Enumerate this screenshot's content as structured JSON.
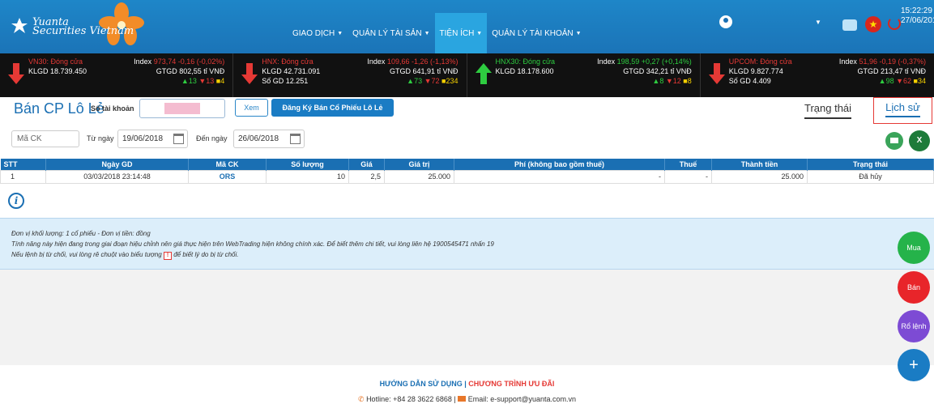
{
  "brand": {
    "logo_text_1": "Yuanta",
    "logo_text_2": "Securities Vietnam"
  },
  "nav": [
    {
      "label": "GIAO DỊCH",
      "has_caret": true
    },
    {
      "label": "QUẢN LÝ TÀI SẢN",
      "has_caret": true
    },
    {
      "label": "TIỆN ÍCH",
      "has_caret": true,
      "active": true
    },
    {
      "label": "QUẢN LÝ TÀI KHOẢN",
      "has_caret": true
    }
  ],
  "clock": {
    "time": "15:22:29",
    "date": "27/06/2018"
  },
  "indices": [
    {
      "name": "VN30: Đóng cửa",
      "klgd": "KLGD 18.739.450",
      "sogd": "",
      "index_label": "Index",
      "index_value": "973,74 -0,16 (-0,02%)",
      "gtgd": "GTGD 802,55 tỉ VNĐ",
      "up": "▲13",
      "down": "▼13",
      "flat": "■4",
      "direction": "down"
    },
    {
      "name": "HNX: Đóng cửa",
      "klgd": "KLGD 42.731.091",
      "sogd": "Số GD 12.251",
      "index_label": "Index",
      "index_value": "109,66 -1,26 (-1,13%)",
      "gtgd": "GTGD 641,91 tỉ VNĐ",
      "up": "▲73",
      "down": "▼72",
      "flat": "■234",
      "direction": "down"
    },
    {
      "name": "HNX30: Đóng cửa",
      "klgd": "KLGD 18.178.600",
      "sogd": "",
      "index_label": "Index",
      "index_value": "198,59 +0,27 (+0,14%)",
      "gtgd": "GTGD 342,21 tỉ VNĐ",
      "up": "▲8",
      "down": "▼12",
      "flat": "■8",
      "direction": "up"
    },
    {
      "name": "UPCOM: Đóng cửa",
      "klgd": "KLGD 9.827.774",
      "sogd": "Số GD 4.409",
      "index_label": "Index",
      "index_value": "51,96 -0,19 (-0,37%)",
      "gtgd": "GTGD 213,47 tỉ VNĐ",
      "up": "▲98",
      "down": "▼62",
      "flat": "■34",
      "direction": "down"
    }
  ],
  "page": {
    "title": "Bán CP Lô Lẻ",
    "account_label": "Số tài khoản",
    "view_button": "Xem",
    "register_button": "Đăng Ký Bán Cổ Phiếu Lô Lẻ",
    "tab_status": "Trạng thái",
    "tab_history": "Lịch sử"
  },
  "filters": {
    "symbol_placeholder": "Mã CK",
    "from_label": "Từ ngày",
    "from_value": "19/06/2018",
    "to_label": "Đến ngày",
    "to_value": "26/06/2018"
  },
  "table": {
    "headers": [
      "STT",
      "Ngày GD",
      "Mã CK",
      "Số lượng",
      "Giá",
      "Giá trị",
      "Phí (không bao gồm thuế)",
      "Thuế",
      "Thành tiền",
      "Trạng thái"
    ],
    "rows": [
      [
        "1",
        "03/03/2018 23:14:48",
        "ORS",
        "10",
        "2,5",
        "25.000",
        "-",
        "-",
        "25.000",
        "Đã hủy"
      ]
    ]
  },
  "notes": {
    "line1": "Đơn vị khối lượng: 1 cổ phiếu - Đơn vị tiền: đồng",
    "line2": "Tính năng này hiện đang trong giai đoạn hiệu chỉnh nên giá thực hiện trên WebTrading hiện không chính xác. Để biết thêm chi tiết, vui lòng liên hệ 1900545471 nhấn 19",
    "line3_a": "Nếu lệnh bị từ chối, vui lòng rê chuột vào biểu tượng",
    "warn_glyph": "!",
    "line3_b": "để biết lý do bị từ chối."
  },
  "fabs": {
    "buy": "Mua",
    "sell": "Bán",
    "basket": "Rổ lệnh",
    "plus": "+"
  },
  "footer": {
    "guide": "HƯỚNG DẪN SỬ DỤNG",
    "sep": "|",
    "promo": "CHƯƠNG TRÌNH ƯU ĐÃI",
    "hotline": "Hotline: +84 28 3622 6868",
    "bar": "|",
    "email": "Email: e-support@yuanta.com.vn"
  },
  "colors": {
    "primary": "#1a6fb3",
    "accent": "#2aa5e0",
    "red": "#e53935",
    "green": "#25b34a"
  }
}
